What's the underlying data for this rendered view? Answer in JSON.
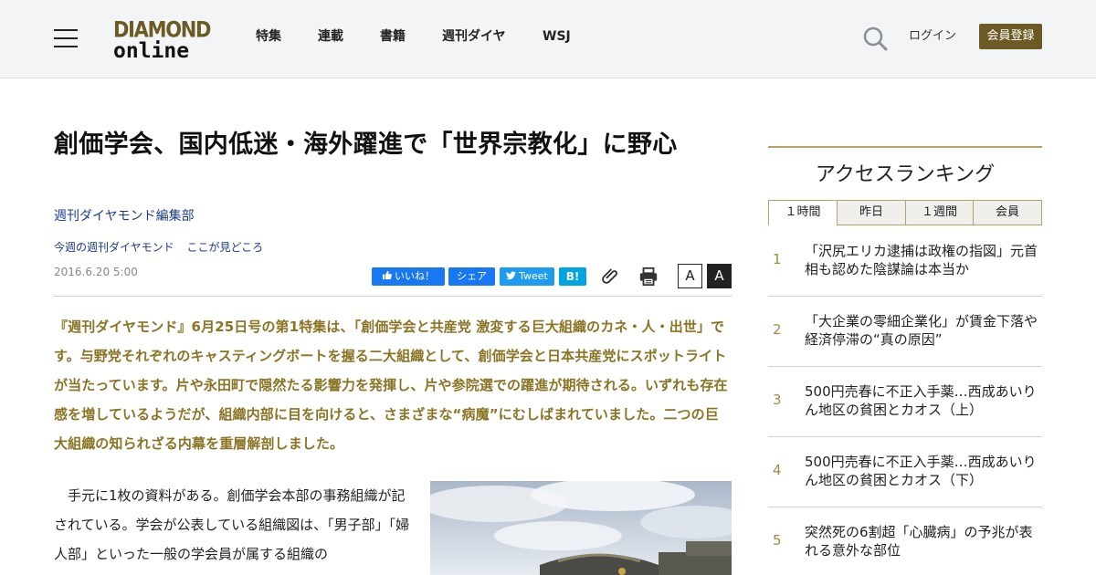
{
  "header": {
    "logo_top": "DIAMOND",
    "logo_bottom": "online",
    "nav": [
      "特集",
      "連載",
      "書籍",
      "週刊ダイヤ",
      "WSJ"
    ],
    "login": "ログイン",
    "register": "会員登録"
  },
  "article": {
    "title": "創価学会、国内低迷・海外躍進で「世界宗教化」に野心",
    "author": "週刊ダイヤモンド編集部",
    "series": [
      "今週の週刊ダイヤモンド",
      "ここが見どころ"
    ],
    "date": "2016.6.20 5:00",
    "share": {
      "like": "いいね！",
      "fb_share": "シェア",
      "tweet": "Tweet",
      "hatena": "B!"
    },
    "font_small": "A",
    "font_large": "A",
    "lead": "『週刊ダイヤモンド』6月25日号の第1特集は、「創価学会と共産党 激変する巨大組織のカネ・人・出世」です。与野党それぞれのキャスティングボートを握る二大組織として、創価学会と日本共産党にスポットライトが当たっています。片や永田町で隠然たる影響力を発揮し、片や参院選での躍進が期待される。いずれも存在感を増しているようだが、組織内部に目を向けると、さまざまな“病魔”にむしばまれていました。二つの巨大組織の知られざる内幕を重層解剖しました。",
    "body": "　手元に1枚の資料がある。創価学会本部の事務組織が記されている。学会が公表している組織図は、「男子部」「婦人部」といった一般の学会員が属する組織の"
  },
  "sidebar": {
    "heading": "アクセスランキング",
    "tabs": [
      "１時間",
      "昨日",
      "１週間",
      "会員"
    ],
    "active_tab": 0,
    "items": [
      {
        "rank": "1",
        "title": "「沢尻エリカ逮捕は政権の指図」元首相も認めた陰謀論は本当か"
      },
      {
        "rank": "2",
        "title": "「大企業の零細企業化」が賃金下落や経済停滞の“真の原因”"
      },
      {
        "rank": "3",
        "title": "500円売春に不正入手薬…西成あいりん地区の貧困とカオス（上）"
      },
      {
        "rank": "4",
        "title": "500円売春に不正入手薬…西成あいりん地区の貧困とカオス（下）"
      },
      {
        "rank": "5",
        "title": "突然死の6割超「心臓病」の予兆が表れる意外な部位"
      }
    ]
  },
  "colors": {
    "brand": "#6b5a23",
    "lead_text": "#8a7424",
    "link": "#1a3b8c",
    "facebook": "#1877f2",
    "twitter": "#1d9bf0",
    "hatena": "#00a4de"
  },
  "icons": [
    "menu-icon",
    "search-icon",
    "like-thumb-icon",
    "twitter-bird-icon",
    "paperclip-icon",
    "print-icon"
  ]
}
